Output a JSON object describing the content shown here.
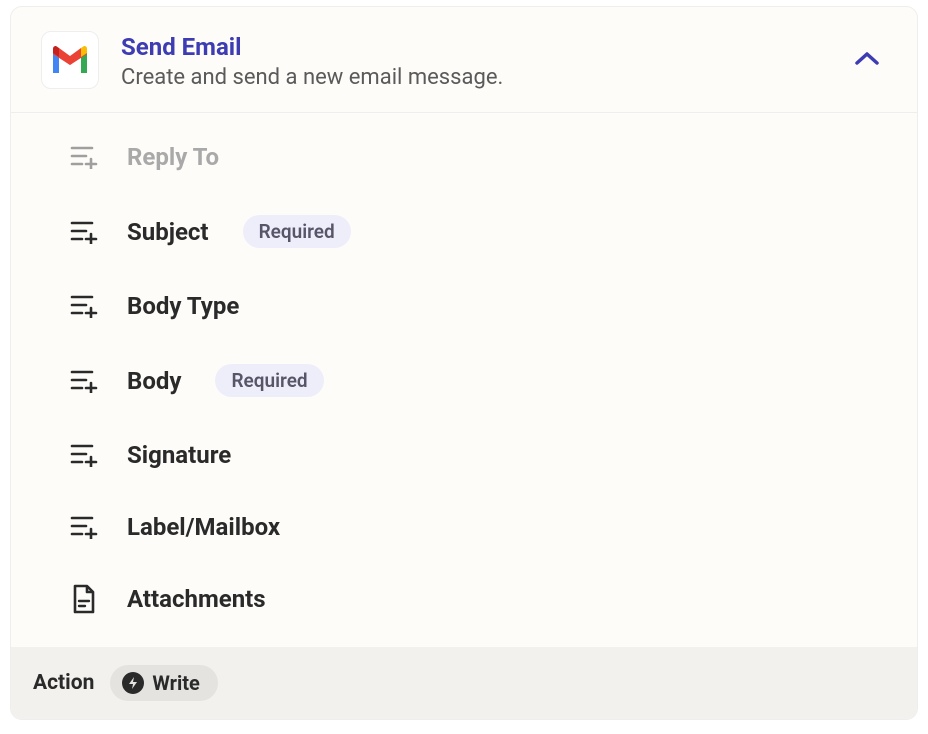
{
  "header": {
    "title": "Send Email",
    "subtitle": "Create and send a new email message.",
    "icon": "gmail-icon",
    "collapse_icon": "chevron-up-icon"
  },
  "fields": [
    {
      "icon": "add-field-icon",
      "label": "Reply To",
      "required": false,
      "muted": true
    },
    {
      "icon": "add-field-icon",
      "label": "Subject",
      "required": true,
      "muted": false
    },
    {
      "icon": "add-field-icon",
      "label": "Body Type",
      "required": false,
      "muted": false
    },
    {
      "icon": "add-field-icon",
      "label": "Body",
      "required": true,
      "muted": false
    },
    {
      "icon": "add-field-icon",
      "label": "Signature",
      "required": false,
      "muted": false
    },
    {
      "icon": "add-field-icon",
      "label": "Label/Mailbox",
      "required": false,
      "muted": false
    },
    {
      "icon": "attachment-icon",
      "label": "Attachments",
      "required": false,
      "muted": false
    }
  ],
  "required_badge_label": "Required",
  "footer": {
    "action_label": "Action",
    "write_label": "Write",
    "write_icon": "bolt-icon"
  }
}
